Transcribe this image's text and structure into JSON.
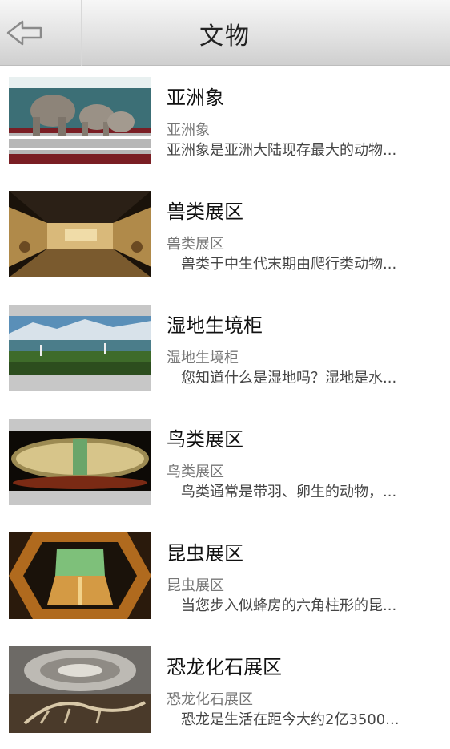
{
  "header": {
    "title": "文物",
    "back_icon": "back-arrow-icon"
  },
  "items": [
    {
      "title": "亚洲象",
      "subtitle": "亚洲象",
      "desc": "亚洲象是亚洲大陆现存最大的动物..."
    },
    {
      "title": "兽类展区",
      "subtitle": "兽类展区",
      "desc": "　兽类于中生代末期由爬行类动物..."
    },
    {
      "title": "湿地生境柜",
      "subtitle": "湿地生境柜",
      "desc": "　您知道什么是湿地吗？湿地是水..."
    },
    {
      "title": "鸟类展区",
      "subtitle": "鸟类展区",
      "desc": "　鸟类通常是带羽、卵生的动物，..."
    },
    {
      "title": "昆虫展区",
      "subtitle": "昆虫展区",
      "desc": "　当您步入似蜂房的六角柱形的昆..."
    },
    {
      "title": "恐龙化石展区",
      "subtitle": "恐龙化石展区",
      "desc": "　恐龙是生活在距今大约2亿3500..."
    }
  ]
}
